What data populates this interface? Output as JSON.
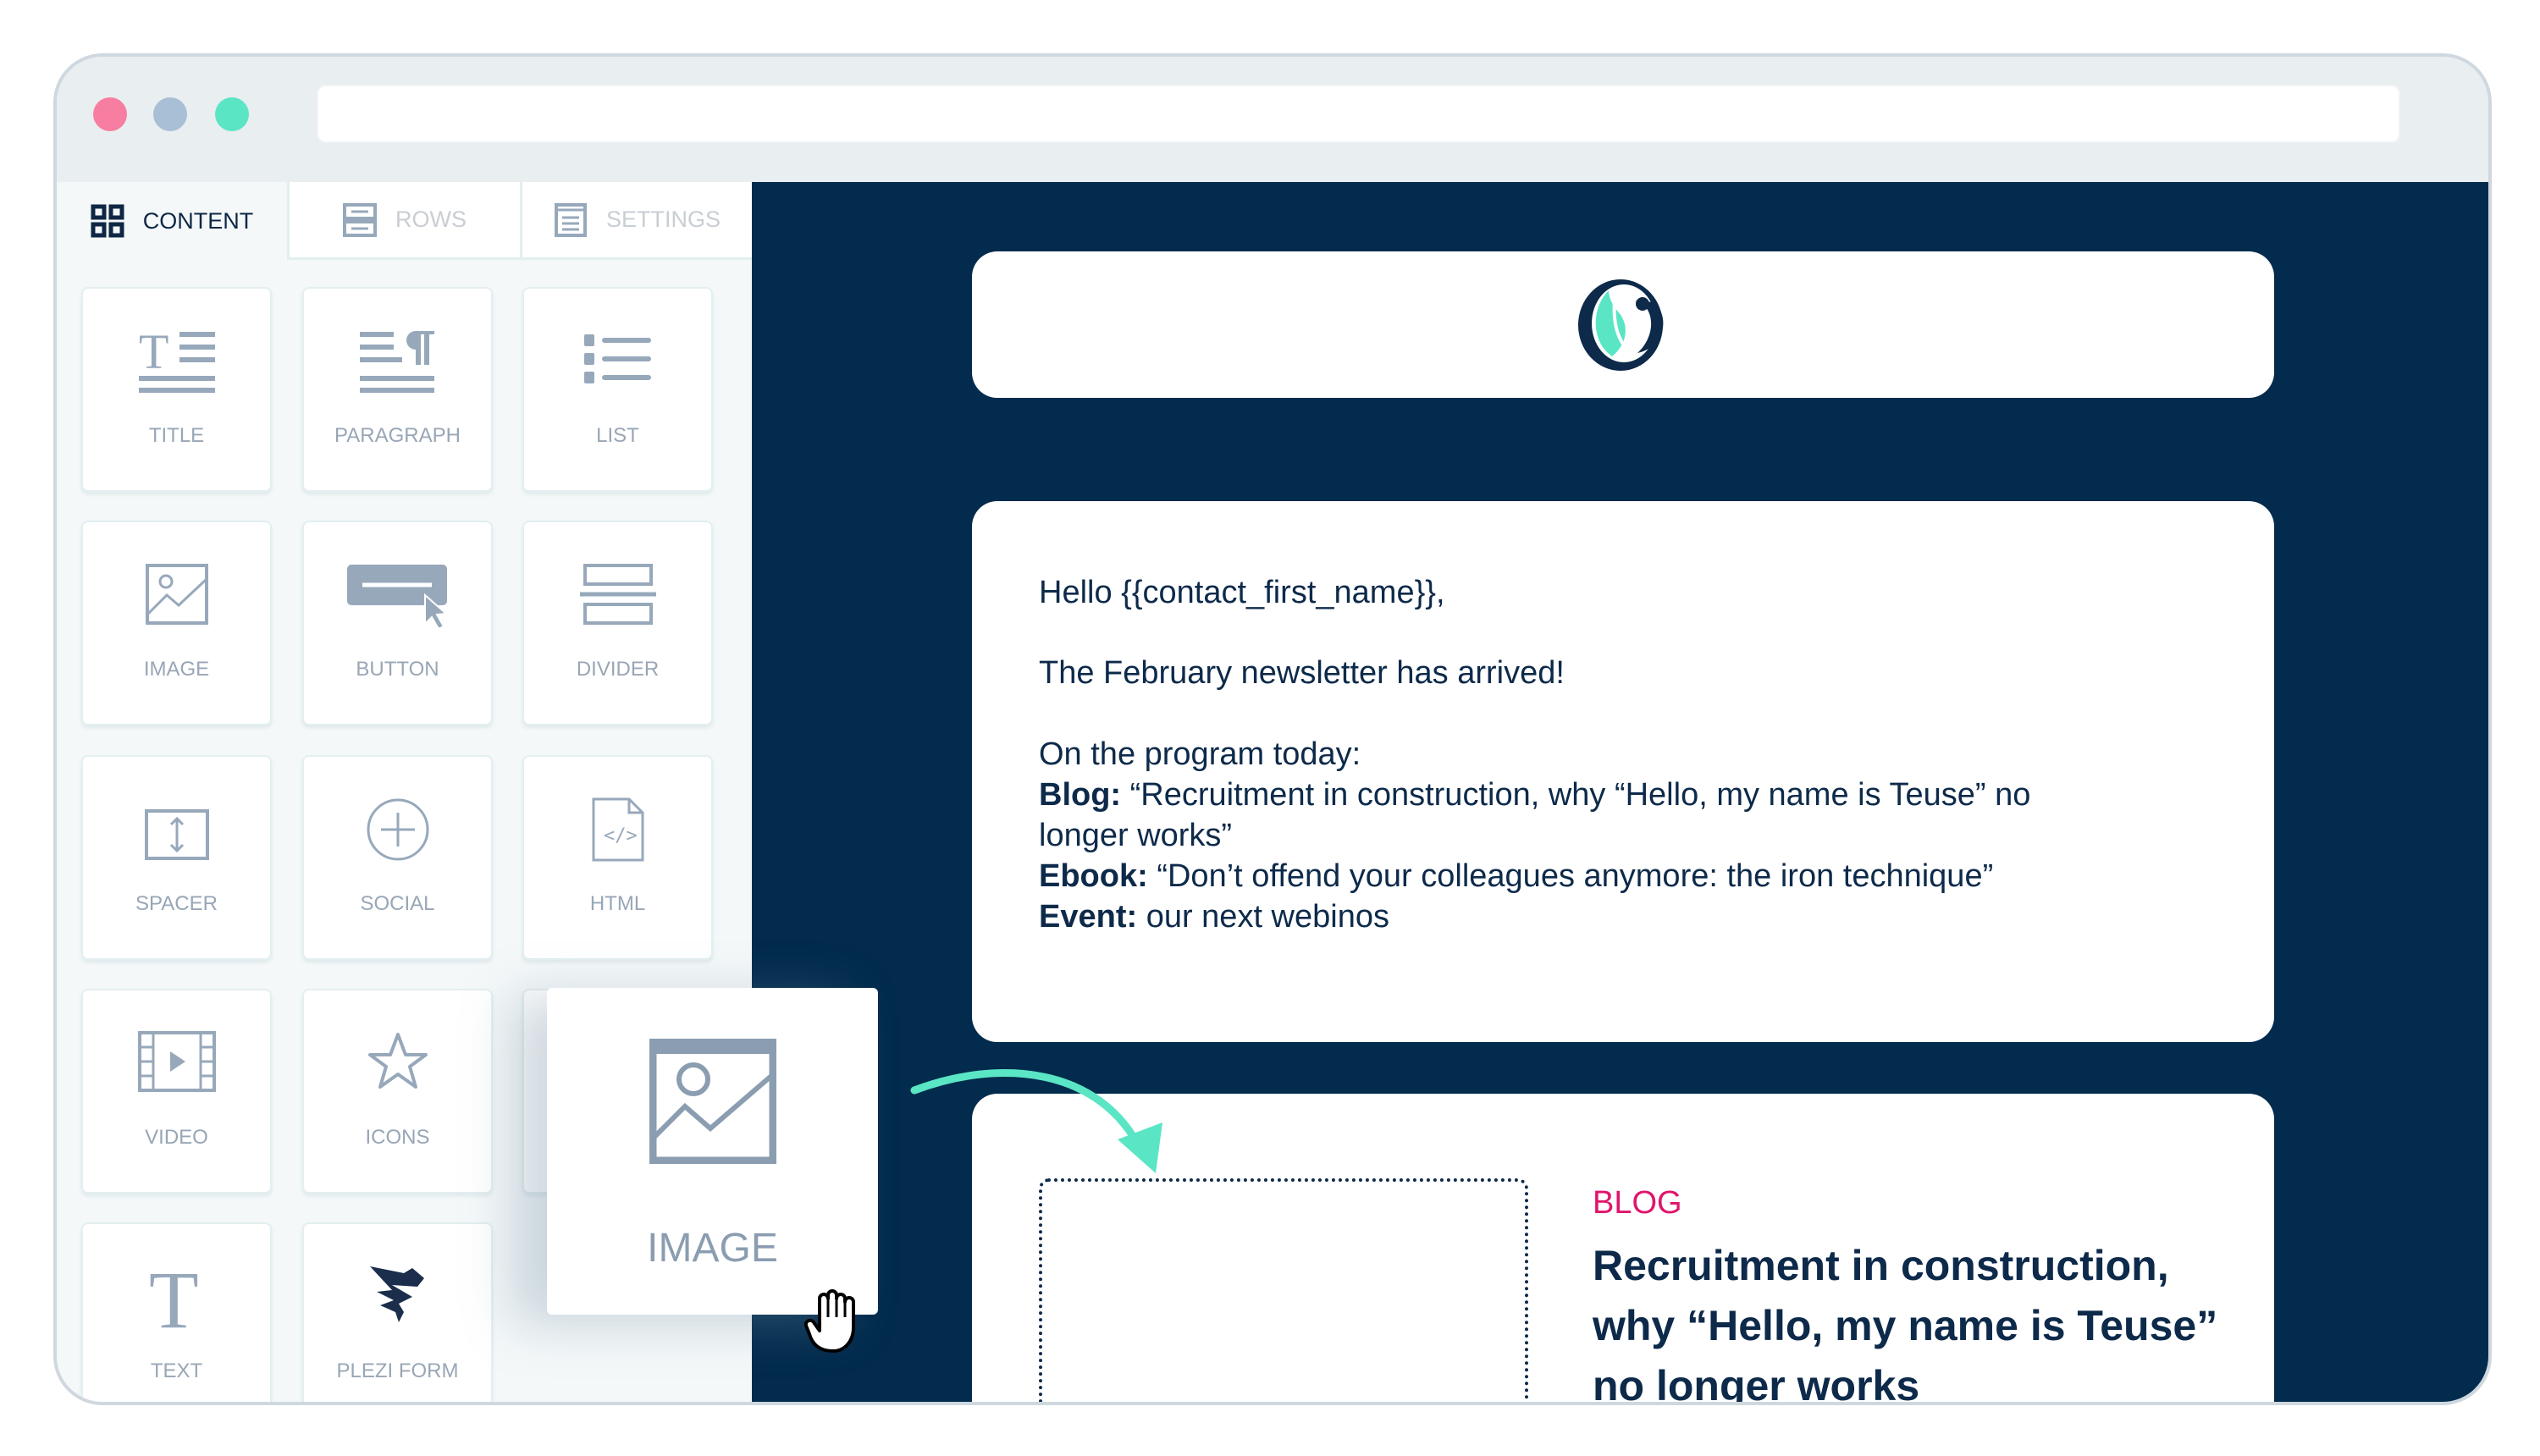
{
  "window": {
    "traffic_lights": [
      "#f77ea0",
      "#a8bfd6",
      "#5ae5c4"
    ],
    "url": ""
  },
  "tabs": [
    {
      "label": "CONTENT",
      "icon": "grid-icon",
      "active": true
    },
    {
      "label": "ROWS",
      "icon": "rows-icon"
    },
    {
      "label": "SETTINGS",
      "icon": "settings-icon"
    }
  ],
  "tiles": [
    {
      "label": "TITLE",
      "icon": "title-icon"
    },
    {
      "label": "PARAGRAPH",
      "icon": "paragraph-icon"
    },
    {
      "label": "LIST",
      "icon": "list-icon"
    },
    {
      "label": "IMAGE",
      "icon": "image-icon"
    },
    {
      "label": "BUTTON",
      "icon": "button-icon"
    },
    {
      "label": "DIVIDER",
      "icon": "divider-icon"
    },
    {
      "label": "SPACER",
      "icon": "spacer-icon"
    },
    {
      "label": "SOCIAL",
      "icon": "plus-circle-icon"
    },
    {
      "label": "HTML",
      "icon": "code-file-icon"
    },
    {
      "label": "VIDEO",
      "icon": "video-icon"
    },
    {
      "label": "ICONS",
      "icon": "star-icon"
    },
    {
      "label": "",
      "icon": ""
    },
    {
      "label": "TEXT",
      "icon": "text-icon"
    },
    {
      "label": "PLEZI FORM",
      "icon": "plezi-form-icon"
    }
  ],
  "drag_tile": {
    "label": "IMAGE",
    "icon": "image-icon"
  },
  "email": {
    "greeting": "Hello {{contact_first_name}},",
    "intro": " The February newsletter has arrived!",
    "program": "On the program today:",
    "blog_label": "Blog:",
    "blog_text": " “Recruitment in construction, why “Hello, my name is Teuse” no",
    "blog_text2": "longer works”",
    "ebook_label": "Ebook:",
    "ebook_text": " “Don’t offend your colleagues anymore: the iron technique”",
    "event_label": "Event:",
    "event_text": " our next webinos",
    "blog_card": {
      "category": "BLOG",
      "title_lines": [
        "Recruitment in construction,",
        "why “Hello, my name is Teuse”",
        "no longer works"
      ]
    }
  },
  "colors": {
    "canvas": "#022b4d",
    "accent": "#5ae5c4",
    "category": "#e0156b",
    "icon": "#97a8bb"
  }
}
